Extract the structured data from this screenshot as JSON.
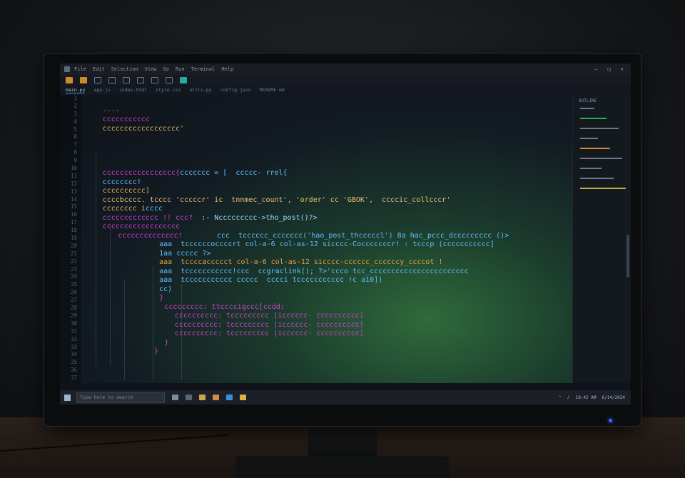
{
  "menubar": {
    "items": [
      "File",
      "Edit",
      "Selection",
      "View",
      "Go",
      "Run",
      "Terminal",
      "Help"
    ],
    "window_controls": [
      "–",
      "□",
      "✕"
    ]
  },
  "tabs": [
    "main.py",
    "app.js",
    "index.html",
    "style.css",
    "utils.py",
    "config.json",
    "README.md"
  ],
  "minimap": {
    "title": "OUTLINE"
  },
  "gutter": [
    "1",
    "2",
    "3",
    "4",
    "5",
    "6",
    "7",
    "8",
    "9",
    "10",
    "11",
    "12",
    "13",
    "14",
    "15",
    "16",
    "17",
    "18",
    "19",
    "20",
    "21",
    "22",
    "23",
    "24",
    "25",
    "26",
    "27",
    "28",
    "29",
    "30",
    "31",
    "32",
    "33",
    "34",
    "35",
    "36",
    "37"
  ],
  "code_lines": [
    {
      "indent": 0,
      "text": "",
      "color": "#e0b35a"
    },
    {
      "indent": 3,
      "text": "----",
      "color": "#3aa0e0"
    },
    {
      "indent": 3,
      "text": "ccccccccccc",
      "color": "#c040d0"
    },
    {
      "indent": 3,
      "text": "cccccccccccccccccc'",
      "color": "#e0b35a"
    },
    {
      "indent": 0,
      "text": "",
      "color": "#e0b35a"
    },
    {
      "indent": 0,
      "text": "",
      "color": "#e0b35a"
    },
    {
      "indent": 0,
      "text": "",
      "color": "#e0b35a"
    },
    {
      "indent": 0,
      "text": "",
      "color": "#e0b35a"
    },
    {
      "indent": 3,
      "text": "ccccccccccccccccc{",
      "color": "#d040d0",
      "tail": "ccccccc = [  ccccc- rrel{",
      "tailColor": "#5fc1ff"
    },
    {
      "indent": 3,
      "text": "cccccccc!",
      "color": "#5fc1ff"
    },
    {
      "indent": 3,
      "text": "cccccccccc]",
      "color": "#e0b35a"
    },
    {
      "indent": 3,
      "text": "cccc",
      "color": "#e0b35a",
      "tail": "bcccc. tcccc 'cccccr' ic  tnnmec_count', 'order' cc 'GBOK',  ccccic_collcccr'",
      "tailColor": "#e8c070"
    },
    {
      "indent": 3,
      "text": "cccccccc i",
      "color": "#e0b35a",
      "tail": "cccc",
      "tailColor": "#5fc1ff"
    },
    {
      "indent": 3,
      "text": "ccccccccccccc !! ccc?",
      "color": "#c040d0",
      "tail": "  :- Nccccccccc->tho_post()?>",
      "tailColor": "#9ad8ff"
    },
    {
      "indent": 3,
      "text": "cccccccccccccccccc",
      "color": "#d040d0"
    },
    {
      "indent": 6,
      "text": "cccccccccccccc!",
      "color": "#d040d0",
      "tail": "        ccc  tcccccc_ccccccc('hao_post_thcccccl') 8a hac_pccc_dccccccccc ()>",
      "tailColor": "#5fc1ff"
    },
    {
      "indent": 14,
      "text": "aaa  tccccccoccccrt col-a-6 col-as-12 sicccc-Cocccccccr! : tcccp (ccccccccccc]",
      "color": "#5fc1ff"
    },
    {
      "indent": 14,
      "text": "1aa ccccc ?>",
      "color": "#5fc1ff"
    },
    {
      "indent": 14,
      "text": "aaa  tccccaccccct col-a-6 col-as-12 sicccc-cccccc_ccccccy_ccccot !",
      "color": "#e8a040"
    },
    {
      "indent": 14,
      "text": "aaa  tccccccccccc!ccc  ccgraclink(); ?>'ccco tcc_ccccccccccccccccccccccc",
      "color": "#5fc1ff"
    },
    {
      "indent": 14,
      "text": "aaa  tccccccccccc ccccc  cccci tccccccccccc !c a10])",
      "color": "#5fc1ff"
    },
    {
      "indent": 14,
      "text": "cc)",
      "color": "#5fc1ff"
    },
    {
      "indent": 14,
      "text": "}",
      "color": "#d040d0"
    },
    {
      "indent": 15,
      "text": "ccccccccc: ttccccigccc[ccdd:",
      "color": "#d040d0"
    },
    {
      "indent": 17,
      "text": "cccccccccc: tccccccccc |icccccc- cccccccccc]",
      "color": "#d040d0"
    },
    {
      "indent": 17,
      "text": "cccccccccc: tccccccccc |icccccc- cccccccccc]",
      "color": "#d040d0"
    },
    {
      "indent": 17,
      "text": "cccccccccc: tccccccccc |icccccc- cccccccccc]",
      "color": "#d040d0"
    },
    {
      "indent": 15,
      "text": "}",
      "color": "#d040d0"
    },
    {
      "indent": 13,
      "text": "}",
      "color": "#d040d0"
    }
  ],
  "colors": {
    "keyword": "#c040d0",
    "string": "#e0b35a",
    "identifier": "#5fc1ff",
    "accent": "#3e8bd6"
  },
  "taskbar": {
    "search_placeholder": "Type here to search",
    "time": "10:42 AM",
    "date": "6/14/2024"
  }
}
